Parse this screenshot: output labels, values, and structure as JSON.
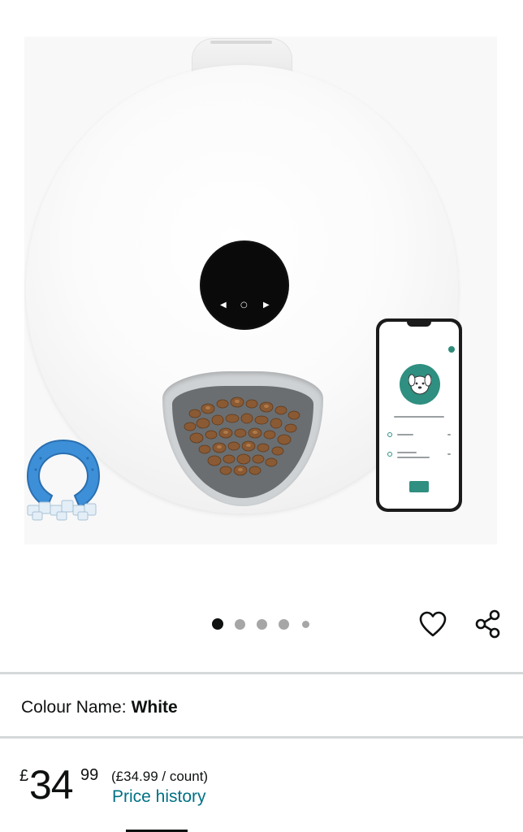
{
  "product_image": {
    "alt": "Automatic pet feeder with food bowl, ice pack and phone app",
    "display_buttons": [
      "◀",
      "○",
      "▶"
    ]
  },
  "carousel": {
    "total_dots": 5,
    "active_index": 0
  },
  "actions": {
    "wishlist_icon": "heart-icon",
    "share_icon": "share-icon"
  },
  "variant": {
    "label": "Colour Name:",
    "value": "White"
  },
  "price": {
    "currency": "£",
    "whole": "34",
    "fraction": "99",
    "unit_price": "(£34.99 / count)",
    "history_link": "Price history"
  },
  "colors": {
    "link": "#007185",
    "text": "#0f1111",
    "divider": "#d5d9d9",
    "dot_inactive": "#a6a6a6"
  }
}
